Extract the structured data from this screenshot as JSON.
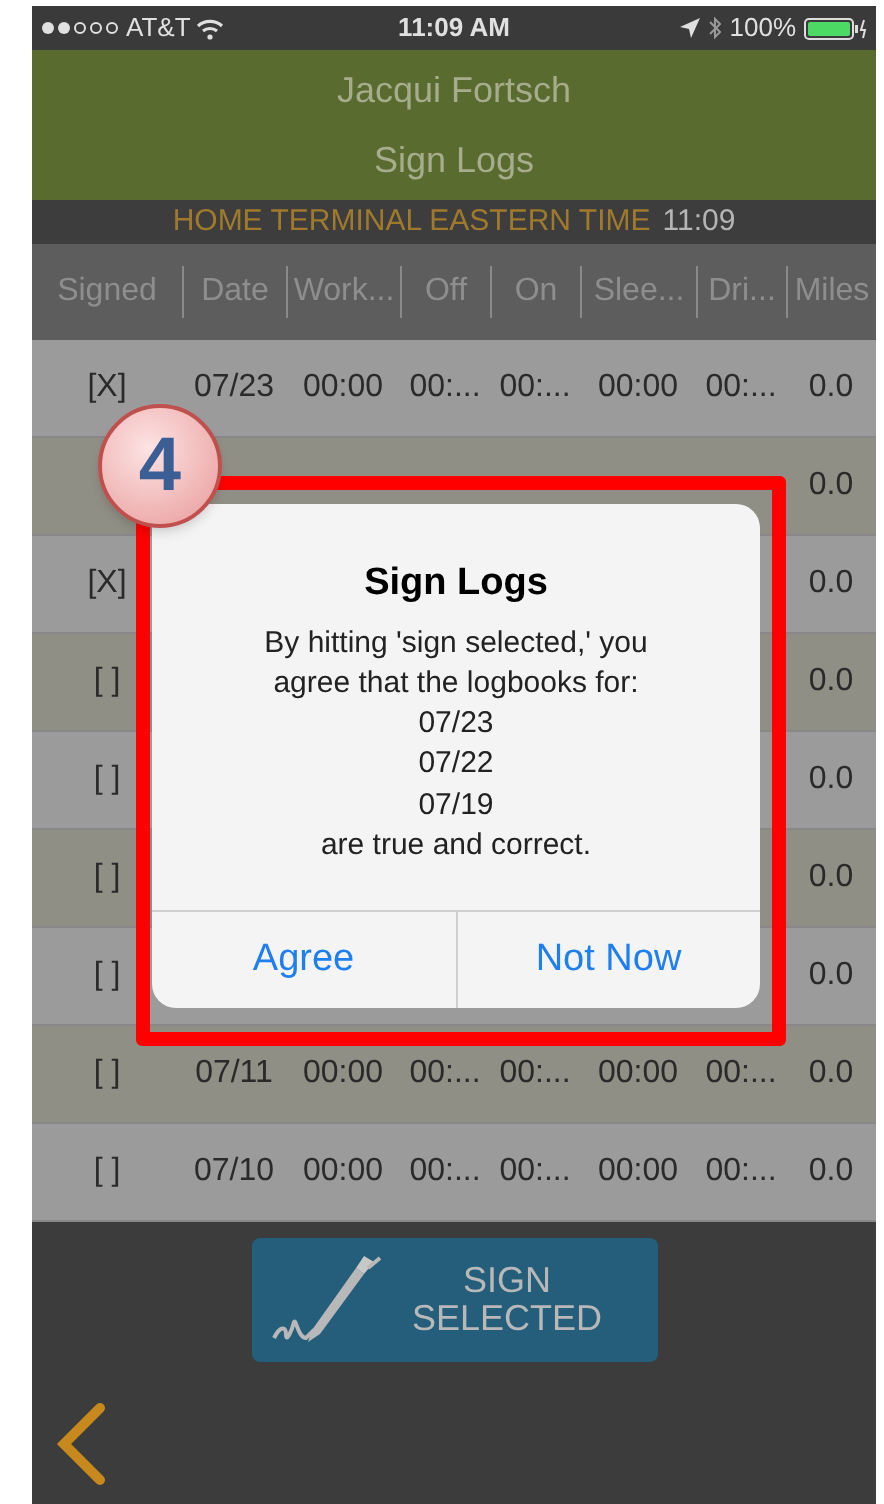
{
  "status_bar": {
    "carrier": "AT&T",
    "time": "11:09 AM",
    "battery": "100%"
  },
  "header": {
    "name": "Jacqui Fortsch",
    "title": "Sign Logs"
  },
  "terminal_bar": {
    "label": "HOME TERMINAL EASTERN TIME",
    "time": "11:09"
  },
  "table": {
    "columns": [
      "Signed",
      "Date",
      "Work...",
      "Off",
      "On",
      "Slee...",
      "Dri...",
      "Miles"
    ],
    "rows": [
      {
        "cells": [
          "[X]",
          "07/23",
          "00:00",
          "00:...",
          "00:...",
          "00:00",
          "00:...",
          "0.0"
        ]
      },
      {
        "cells": [
          null,
          null,
          null,
          null,
          null,
          null,
          null,
          "0.0"
        ]
      },
      {
        "cells": [
          "[X]",
          null,
          null,
          null,
          null,
          null,
          null,
          "0.0"
        ]
      },
      {
        "cells": [
          "[ ]",
          null,
          null,
          null,
          null,
          null,
          null,
          "0.0"
        ]
      },
      {
        "cells": [
          "[ ]",
          null,
          null,
          null,
          null,
          null,
          null,
          "0.0"
        ]
      },
      {
        "cells": [
          "[ ]",
          null,
          null,
          null,
          null,
          null,
          null,
          "0.0"
        ]
      },
      {
        "cells": [
          "[ ]",
          null,
          null,
          null,
          null,
          null,
          null,
          "0.0"
        ]
      },
      {
        "cells": [
          "[ ]",
          "07/11",
          "00:00",
          "00:...",
          "00:...",
          "00:00",
          "00:...",
          "0.0"
        ]
      },
      {
        "cells": [
          "[ ]",
          "07/10",
          "00:00",
          "00:...",
          "00:...",
          "00:00",
          "00:...",
          "0.0"
        ]
      }
    ]
  },
  "sign_button": {
    "label": "SIGN\nSELECTED"
  },
  "dialog": {
    "title": "Sign Logs",
    "message": "By hitting 'sign selected,' you\nagree that the logbooks for:\n07/23\n07/22\n07/19\nare true and correct.",
    "buttons": [
      "Agree",
      "Not Now"
    ]
  },
  "step_badge": {
    "number": "4"
  }
}
